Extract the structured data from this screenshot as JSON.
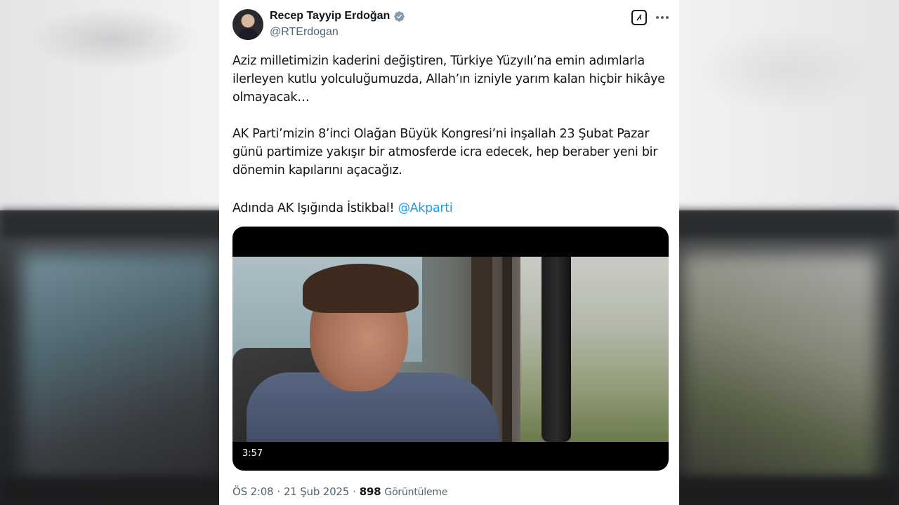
{
  "tweet": {
    "author_name": "Recep Tayyip Erdoğan",
    "author_handle": "@RTErdogan",
    "verified": true,
    "paragraph_1": "Aziz milletimizin kaderini değiştiren, Türkiye Yüzyılı’na emin adımlarla ilerleyen kutlu yolculuğumuzda, Allah’ın izniyle yarım kalan hiçbir hikâye olmayacak…",
    "paragraph_2": "AK Parti’mizin 8’inci Olağan Büyük Kongresi’ni inşallah 23 Şubat Pazar günü partimize yakışır bir atmosferde icra edecek, hep beraber yeni bir dönemin kapılarını açacağız.",
    "paragraph_3_text": "Adında AK Işığında İstikbal! ",
    "mention": "@Akparti",
    "video_duration": "3:57",
    "time": "ÖS 2:08",
    "separator": "·",
    "date": "21 Şub 2025",
    "views_count": "898",
    "views_label": "Görüntüleme"
  },
  "icons": {
    "verified": "verified-badge-icon",
    "grok": "grok-icon",
    "more": "more-icon"
  },
  "colors": {
    "link": "#1d9bf0",
    "secondary_text": "#536471",
    "primary_text": "#0f1419"
  }
}
